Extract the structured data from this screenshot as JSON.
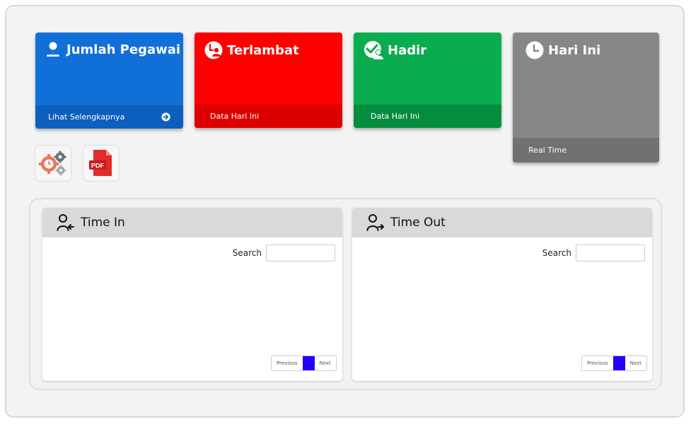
{
  "cards": {
    "employees": {
      "title": "Jumlah Pegawai",
      "footer": "Lihat Selengkapnya",
      "icon": "user-icon",
      "color": "#1170d8"
    },
    "late": {
      "title": "Terlambat",
      "footer": "Data Hari Ini",
      "icon": "user-clock-icon",
      "color": "#ff0000"
    },
    "present": {
      "title": "Hadir",
      "footer": "Data Hari Ini",
      "icon": "user-check-icon",
      "color": "#09ad50"
    },
    "today": {
      "title": "Hari Ini",
      "footer": "Real Time",
      "icon": "clock-icon",
      "color": "#868786"
    }
  },
  "tools": [
    {
      "icon": "settings-gears-icon"
    },
    {
      "icon": "pdf-file-icon",
      "label": "PDF"
    }
  ],
  "panels": {
    "time_in": {
      "title": "Time In",
      "search_label": "Search",
      "search_value": "",
      "pager": {
        "previous": "Previous",
        "next": "Next"
      }
    },
    "time_out": {
      "title": "Time Out",
      "search_label": "Search",
      "search_value": "",
      "pager": {
        "previous": "Previous",
        "next": "Next"
      }
    }
  }
}
